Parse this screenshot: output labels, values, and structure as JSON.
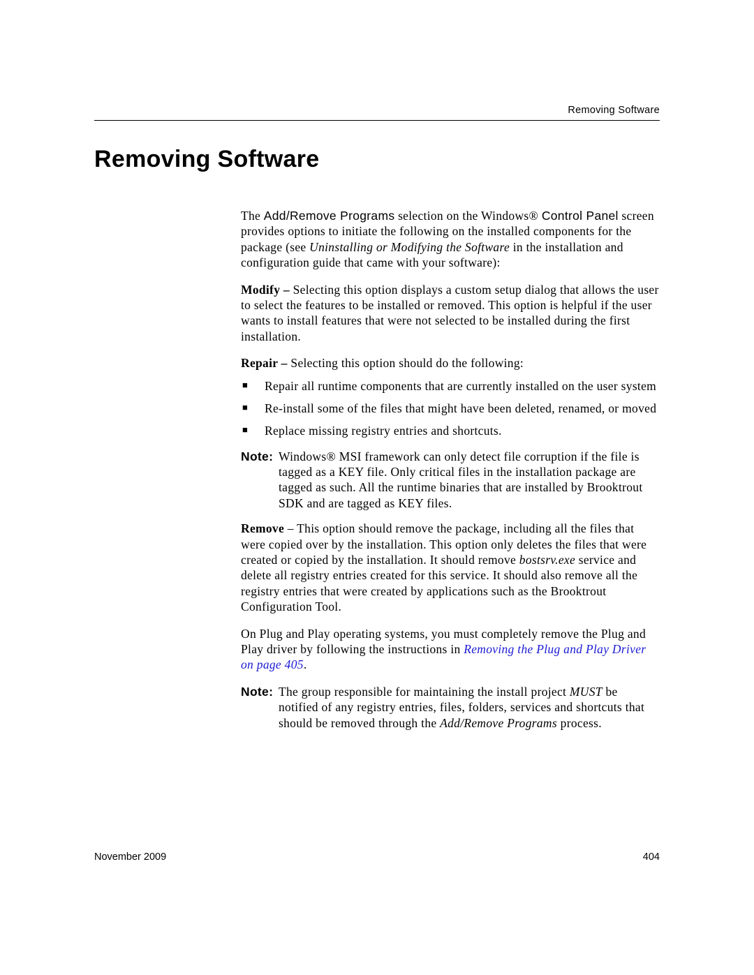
{
  "header": {
    "running": "Removing Software"
  },
  "title": "Removing Software",
  "body": {
    "intro": {
      "pre": "The ",
      "addremove": "Add/Remove Programs",
      "mid": " selection on the Windows® ",
      "controlpanel": "Control Panel",
      "after": " screen provides options to initiate the following on the installed components for the package (see ",
      "ref": "Uninstalling or Modifying the Software",
      "tail": " in the installation and configuration guide that came with your software):"
    },
    "modify": {
      "label": "Modify –",
      "text": " Selecting this option displays a custom setup dialog that allows the user to select the features to be installed or removed. This option is helpful if the user wants to install features that were not selected to be installed during the first installation."
    },
    "repair": {
      "label": "Repair –",
      "text": " Selecting this option should do the following:",
      "items": [
        "Repair all runtime components that are currently installed on the user system",
        "Re-install some of the files that might have been deleted, renamed, or moved",
        "Replace missing registry entries and shortcuts."
      ]
    },
    "note1": {
      "label": "Note:",
      "text": "Windows® MSI framework can only detect file corruption if the file is tagged as a KEY file. Only critical files in the installation package are tagged as such. All the runtime binaries that are installed by Brooktrout SDK and are tagged as KEY files."
    },
    "remove": {
      "label": "Remove",
      "dash": " – ",
      "text1": "This option should remove the package, including all the files that were copied over by the installation. This option only deletes the files that were created or copied by the installation. It should remove ",
      "exe": "bostsrv.exe",
      "text2": " service and delete all registry entries created for this service. It should also remove all the registry entries that were created by applications such as the Brooktrout Configuration Tool."
    },
    "pnp": {
      "text1": "On Plug and Play operating systems, you must completely remove the Plug and Play driver by following the instructions in ",
      "link": "Removing the Plug and Play Driver on page 405",
      "text2": "."
    },
    "note2": {
      "label": "Note:",
      "text1": "The group responsible for maintaining the install project ",
      "must": "MUST",
      "text2": " be notified of any registry entries, files, folders, services and shortcuts that should be removed through the ",
      "proc": "Add/Remove Programs",
      "text3": " process."
    }
  },
  "footer": {
    "date": "November 2009",
    "page": "404"
  }
}
